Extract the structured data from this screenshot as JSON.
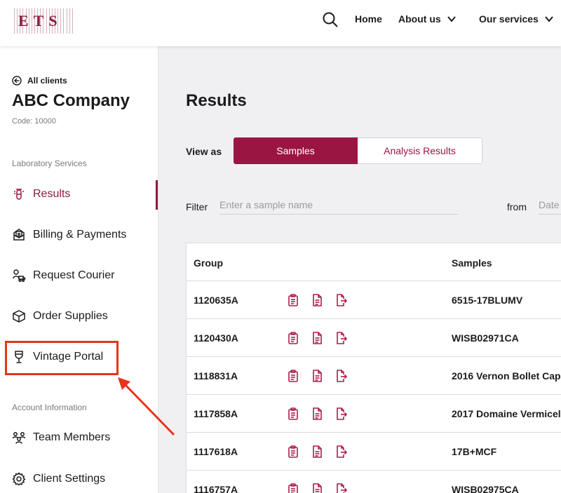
{
  "header": {
    "logo_text": "ETS",
    "nav": [
      {
        "label": "Home"
      },
      {
        "label": "About us"
      },
      {
        "label": "Our services"
      }
    ]
  },
  "sidebar": {
    "back_label": "All clients",
    "client_name": "ABC Company",
    "client_code": "Code: 10000",
    "lab_section_label": "Laboratory Services",
    "lab_items": [
      {
        "label": "Results",
        "icon": "test-tube-icon",
        "active": true
      },
      {
        "label": "Billing & Payments",
        "icon": "invoice-icon"
      },
      {
        "label": "Request Courier",
        "icon": "courier-icon"
      },
      {
        "label": "Order Supplies",
        "icon": "box-icon"
      },
      {
        "label": "Vintage Portal",
        "icon": "wine-glass-icon"
      }
    ],
    "account_section_label": "Account Information",
    "account_items": [
      {
        "label": "Team Members",
        "icon": "team-icon"
      },
      {
        "label": "Client Settings",
        "icon": "gear-icon"
      }
    ]
  },
  "main": {
    "title": "Results",
    "view_as_label": "View as",
    "view_options": [
      "Samples",
      "Analysis Results"
    ],
    "selected_view": "Samples",
    "filter_label": "Filter",
    "filter_placeholder": "Enter a sample name",
    "from_label": "from",
    "date_placeholder": "Date",
    "table": {
      "columns": [
        "Group",
        "Samples"
      ],
      "rows": [
        {
          "group": "1120635A",
          "sample": "6515-17BLUMV"
        },
        {
          "group": "1120430A",
          "sample": "WISB02971CA"
        },
        {
          "group": "1118831A",
          "sample": "2016 Vernon Bollet Cap"
        },
        {
          "group": "1117858A",
          "sample": "2017 Domaine Vermicel"
        },
        {
          "group": "1117618A",
          "sample": "17B+MCF"
        },
        {
          "group": "1116757A",
          "sample": "WISB02975CA"
        }
      ]
    }
  },
  "colors": {
    "brand": "#9b1543",
    "annotation": "#e8321e"
  }
}
